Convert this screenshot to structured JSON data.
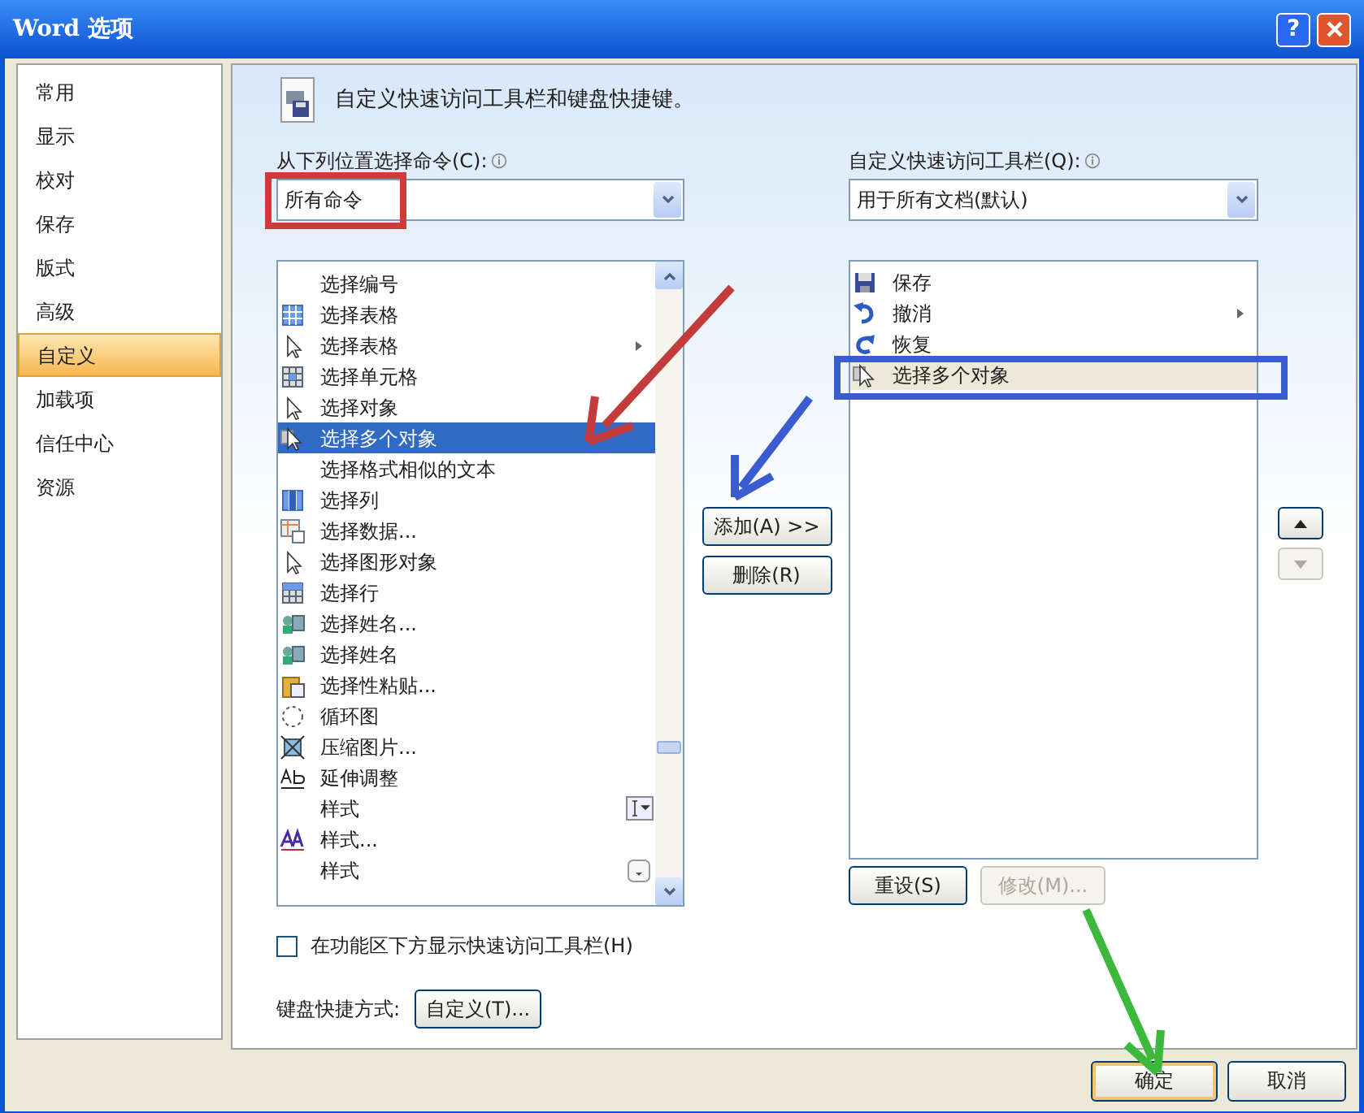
{
  "window": {
    "title": "Word 选项",
    "help_button": "?"
  },
  "sidebar": {
    "items": [
      {
        "label": "常用",
        "selected": false
      },
      {
        "label": "显示",
        "selected": false
      },
      {
        "label": "校对",
        "selected": false
      },
      {
        "label": "保存",
        "selected": false
      },
      {
        "label": "版式",
        "selected": false
      },
      {
        "label": "高级",
        "selected": false
      },
      {
        "label": "自定义",
        "selected": true
      },
      {
        "label": "加载项",
        "selected": false
      },
      {
        "label": "信任中心",
        "selected": false
      },
      {
        "label": "资源",
        "selected": false
      }
    ]
  },
  "heading": "自定义快速访问工具栏和键盘快捷键。",
  "commands_source": {
    "label": "从下列位置选择命令(C):",
    "value": "所有命令"
  },
  "toolbar_scope": {
    "label": "自定义快速访问工具栏(Q):",
    "value": "用于所有文档(默认)"
  },
  "commands": [
    {
      "label": "选择编号",
      "selected": false
    },
    {
      "label": "选择表格",
      "selected": false
    },
    {
      "label": "选择表格",
      "selected": false,
      "kind": "submenu"
    },
    {
      "label": "选择单元格",
      "selected": false
    },
    {
      "label": "选择对象",
      "selected": false
    },
    {
      "label": "选择多个对象",
      "selected": true
    },
    {
      "label": "选择格式相似的文本",
      "selected": false
    },
    {
      "label": "选择列",
      "selected": false
    },
    {
      "label": "选择数据...",
      "selected": false
    },
    {
      "label": "选择图形对象",
      "selected": false
    },
    {
      "label": "选择行",
      "selected": false
    },
    {
      "label": "选择姓名...",
      "selected": false
    },
    {
      "label": "选择姓名",
      "selected": false
    },
    {
      "label": "选择性粘贴...",
      "selected": false
    },
    {
      "label": "循环图",
      "selected": false
    },
    {
      "label": "压缩图片...",
      "selected": false
    },
    {
      "label": "延伸调整",
      "selected": false
    },
    {
      "label": "样式",
      "selected": false,
      "kind": "text-combo"
    },
    {
      "label": "样式...",
      "selected": false
    },
    {
      "label": "样式",
      "selected": false,
      "kind": "dropdown"
    }
  ],
  "add_button": "添加(A) >>",
  "remove_button": "删除(R)",
  "toolbar_items": [
    {
      "label": "保存",
      "selected": false
    },
    {
      "label": "撤消",
      "selected": false,
      "kind": "submenu"
    },
    {
      "label": "恢复",
      "selected": false
    },
    {
      "label": "选择多个对象",
      "selected": true
    }
  ],
  "reset_button": {
    "label": "重设(S)",
    "disabled": false
  },
  "modify_button": {
    "label": "修改(M)...",
    "disabled": true
  },
  "show_below_ribbon": {
    "label": "在功能区下方显示快速访问工具栏(H)",
    "checked": false
  },
  "keyboard": {
    "label": "键盘快捷方式:",
    "button": "自定义(T)..."
  },
  "ok_button": "确定",
  "cancel_button": "取消"
}
